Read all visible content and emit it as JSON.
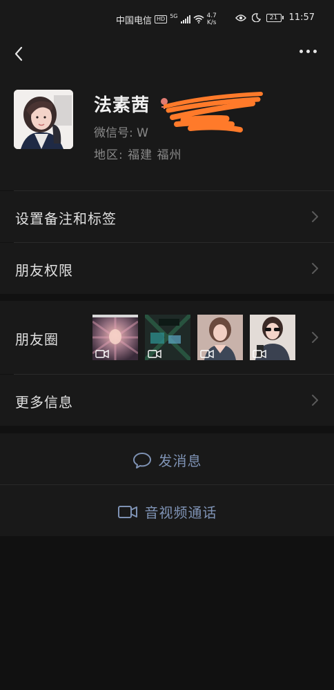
{
  "status_bar": {
    "carrier": "中国电信",
    "hd_badge": "HD",
    "network_badge": "5G",
    "speed_value": "4.7",
    "speed_unit": "K/s",
    "battery_level": "21",
    "time": "11:57"
  },
  "profile": {
    "name": "法素茜",
    "wechat_id_label": "微信号: ",
    "wechat_id_visible": "W",
    "region_label": "地区: ",
    "region_value": "福建  福州"
  },
  "menu": {
    "remark_tags": "设置备注和标签",
    "friend_permissions": "朋友权限",
    "moments": "朋友圈",
    "more_info": "更多信息"
  },
  "actions": {
    "send_message": "发消息",
    "av_call": "音视频通话"
  },
  "colors": {
    "background": "#111111",
    "panel": "#191919",
    "accent_link": "#7f93b5",
    "redaction": "#ff7a2a",
    "gender_icon": "#e07b72"
  },
  "icons": {
    "back": "chevron-left-icon",
    "more": "more-dots-icon",
    "gender": "female-icon",
    "chevron": "chevron-right-icon",
    "video": "video-icon",
    "chat": "chat-bubble-icon",
    "video_call": "video-camera-icon"
  }
}
